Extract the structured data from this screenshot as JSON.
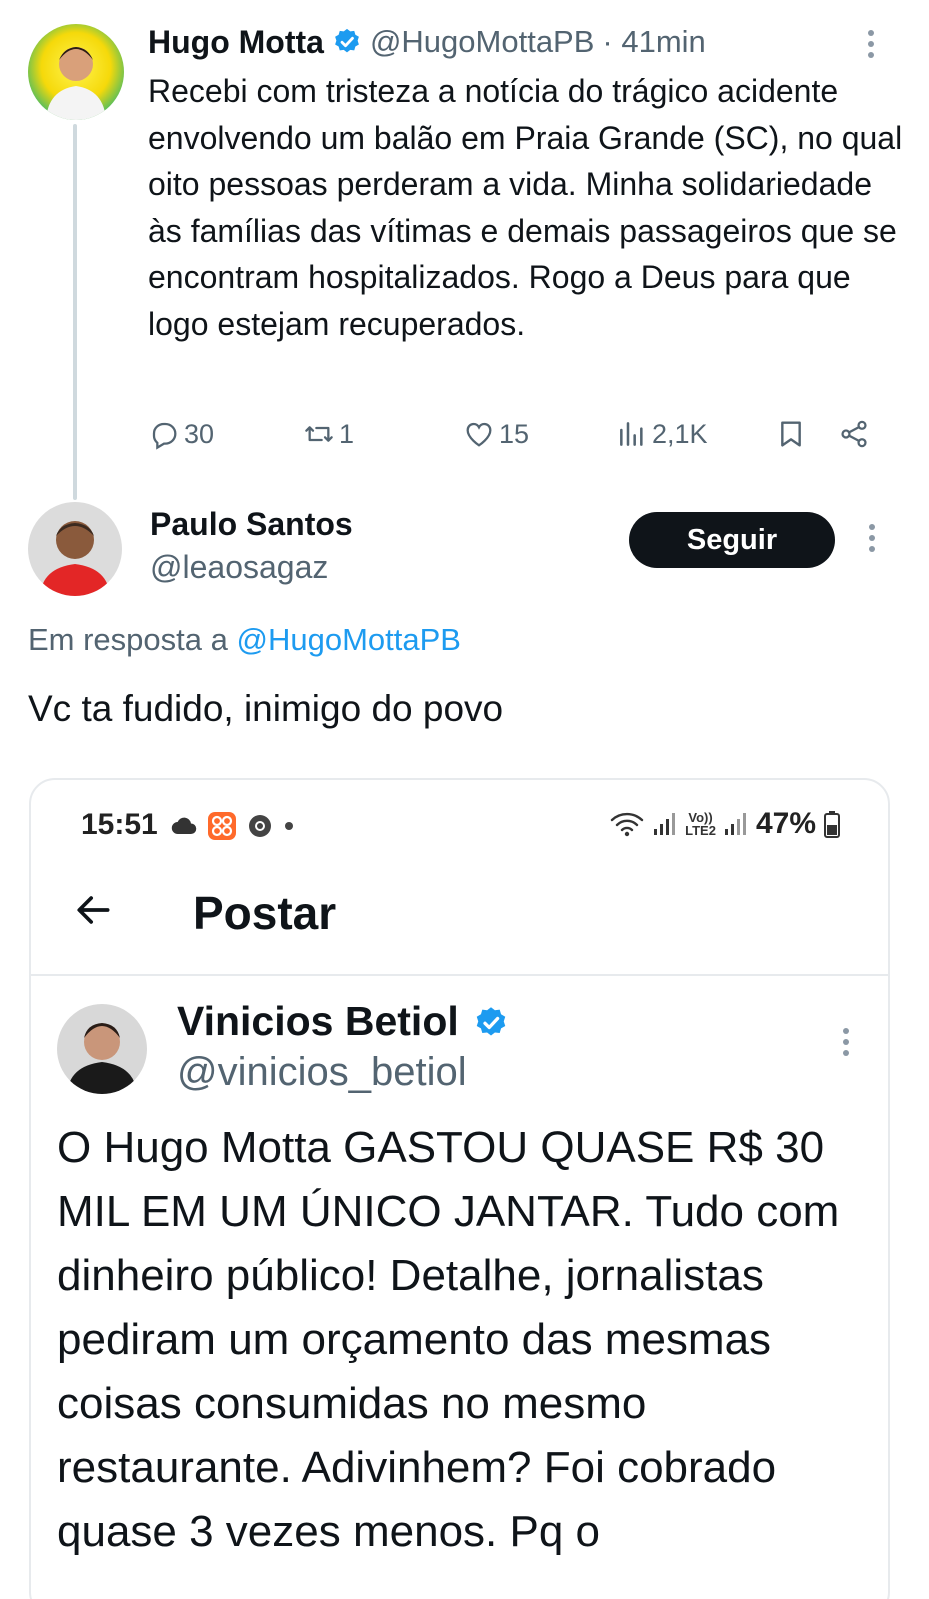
{
  "parent_tweet": {
    "name": "Hugo Motta",
    "handle": "@HugoMottaPB",
    "time": "· 41min",
    "text": "Recebi com tristeza a notícia do trágico acidente envolvendo um balão em Praia Grande (SC), no qual oito pessoas perderam a vida. Minha solidariedade às famílias das vítimas e demais passageiros que se encontram hospitalizados. Rogo a Deus para que logo estejam recuperados.",
    "replies": "30",
    "retweets": "1",
    "likes": "15",
    "views": "2,1K"
  },
  "reply_tweet": {
    "name": "Paulo Santos",
    "handle": "@leaosagaz",
    "follow_label": "Seguir",
    "reply_to_prefix": "Em resposta a",
    "reply_to_mention": "@HugoMottaPB",
    "text": "Vc ta fudido, inimigo do povo"
  },
  "embedded_screenshot": {
    "status_bar": {
      "time": "15:51",
      "battery": "47%",
      "network_top": "Vo))",
      "network_bottom": "LTE2"
    },
    "page_title": "Postar",
    "tweet": {
      "name": "Vinicios Betiol",
      "handle": "@vinicios_betiol",
      "text": "O Hugo Motta GASTOU QUASE R$ 30 MIL EM UM ÚNICO JANTAR. Tudo com dinheiro público! Detalhe, jornalistas pediram um orçamento das mesmas coisas consumidas no mesmo restaurante. Adivinhem? Foi cobrado quase 3 vezes menos. Pq o"
    }
  },
  "colors": {
    "text": "#0f1419",
    "secondary": "#536471",
    "link": "#1d9bf0",
    "verified": "#1d9bf0",
    "follow_bg": "#0f1419",
    "divider": "#e7eaed"
  },
  "icons": [
    "reply-icon",
    "retweet-icon",
    "like-icon",
    "views-icon",
    "bookmark-icon",
    "share-icon",
    "verified-icon",
    "more-icon",
    "back-arrow-icon",
    "cloud-icon",
    "app-icon",
    "chrome-icon",
    "wifi-icon",
    "signal-icon",
    "battery-icon"
  ]
}
